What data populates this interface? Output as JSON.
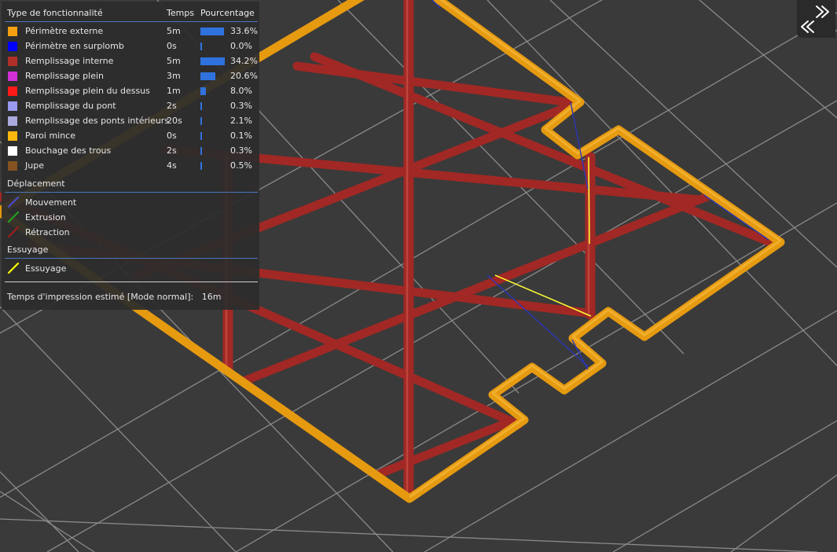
{
  "legend": {
    "header_feature": "Type de fonctionnalité",
    "header_time": "Temps",
    "header_percent": "Pourcentage",
    "features": [
      {
        "label": "Périmètre externe",
        "time": "5m",
        "percent": "33.6%",
        "value": 33.6,
        "color": "#f5a012"
      },
      {
        "label": "Périmètre en surplomb",
        "time": "0s",
        "percent": "0.0%",
        "value": 0.0,
        "color": "#0000ff"
      },
      {
        "label": "Remplissage interne",
        "time": "5m",
        "percent": "34.2%",
        "value": 34.2,
        "color": "#b03029"
      },
      {
        "label": "Remplissage plein",
        "time": "3m",
        "percent": "20.6%",
        "value": 20.6,
        "color": "#d22fd6"
      },
      {
        "label": "Remplissage plein du dessus",
        "time": "1m",
        "percent": "8.0%",
        "value": 8.0,
        "color": "#ff1a1a"
      },
      {
        "label": "Remplissage du pont",
        "time": "2s",
        "percent": "0.3%",
        "value": 0.3,
        "color": "#9a9af2"
      },
      {
        "label": "Remplissage des ponts intérieurs",
        "time": "20s",
        "percent": "2.1%",
        "value": 2.1,
        "color": "#aaaadd"
      },
      {
        "label": "Paroi mince",
        "time": "0s",
        "percent": "0.1%",
        "value": 0.1,
        "color": "#ffb80e"
      },
      {
        "label": "Bouchage des trous",
        "time": "2s",
        "percent": "0.3%",
        "value": 0.3,
        "color": "#ffffff"
      },
      {
        "label": "Jupe",
        "time": "4s",
        "percent": "0.5%",
        "value": 0.5,
        "color": "#845321"
      }
    ],
    "travel_section": "Déplacement",
    "travel": [
      {
        "label": "Mouvement",
        "color": "#4a4acb",
        "icon": "line-icon"
      },
      {
        "label": "Extrusion",
        "color": "#21a021",
        "icon": "line-icon"
      },
      {
        "label": "Rétraction",
        "color": "#a11d1d",
        "icon": "line-icon"
      }
    ],
    "wipe_section": "Essuyage",
    "wipe": [
      {
        "label": "Essuyage",
        "color": "#ffff00",
        "icon": "line-icon"
      }
    ],
    "estimate_label": "Temps d'impression estimé [Mode normal]:",
    "estimate_value": "16m"
  },
  "collapse_button": {
    "icon": "double-chevron-icon"
  },
  "colors": {
    "background": "#3a3a3a",
    "grid": "#8c8c8c",
    "perimeter": "#e3960e",
    "infill": "#a52a26",
    "travel": "#2a36b8",
    "wipe": "#ffff33"
  }
}
